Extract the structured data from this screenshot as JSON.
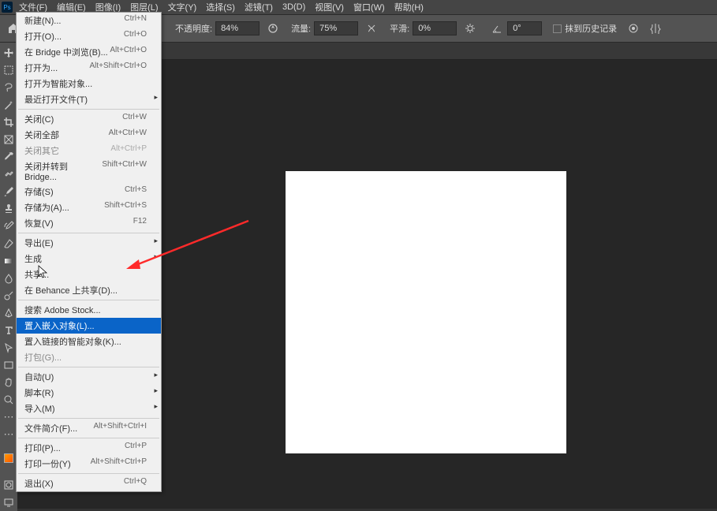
{
  "menubar": {
    "items": [
      "文件(F)",
      "编辑(E)",
      "图像(I)",
      "图层(L)",
      "文字(Y)",
      "选择(S)",
      "滤镜(T)",
      "3D(D)",
      "视图(V)",
      "窗口(W)",
      "帮助(H)"
    ]
  },
  "optionbar": {
    "opacity_label": "不透明度:",
    "opacity_value": "84%",
    "flow_label": "流量:",
    "flow_value": "75%",
    "smoothing_label": "平滑:",
    "smoothing_value": "0%",
    "angle_value": "0°",
    "history_label": "抹到历史记录"
  },
  "dropdown": {
    "items": [
      {
        "label": "新建(N)...",
        "shortcut": "Ctrl+N"
      },
      {
        "label": "打开(O)...",
        "shortcut": "Ctrl+O"
      },
      {
        "label": "在 Bridge 中浏览(B)...",
        "shortcut": "Alt+Ctrl+O"
      },
      {
        "label": "打开为...",
        "shortcut": "Alt+Shift+Ctrl+O"
      },
      {
        "label": "打开为智能对象..."
      },
      {
        "label": "最近打开文件(T)",
        "sub": true
      },
      {
        "sep": true
      },
      {
        "label": "关闭(C)",
        "shortcut": "Ctrl+W"
      },
      {
        "label": "关闭全部",
        "shortcut": "Alt+Ctrl+W"
      },
      {
        "label": "关闭其它",
        "shortcut": "Alt+Ctrl+P",
        "disabled": true
      },
      {
        "label": "关闭并转到 Bridge...",
        "shortcut": "Shift+Ctrl+W"
      },
      {
        "label": "存储(S)",
        "shortcut": "Ctrl+S"
      },
      {
        "label": "存储为(A)...",
        "shortcut": "Shift+Ctrl+S"
      },
      {
        "label": "恢复(V)",
        "shortcut": "F12"
      },
      {
        "sep": true
      },
      {
        "label": "导出(E)",
        "sub": true
      },
      {
        "label": "生成",
        "sub": true
      },
      {
        "label": "共享..."
      },
      {
        "label": "在 Behance 上共享(D)..."
      },
      {
        "sep": true
      },
      {
        "label": "搜索 Adobe Stock..."
      },
      {
        "label": "置入嵌入对象(L)...",
        "highlighted": true
      },
      {
        "label": "置入链接的智能对象(K)..."
      },
      {
        "label": "打包(G)...",
        "disabled": true
      },
      {
        "sep": true
      },
      {
        "label": "自动(U)",
        "sub": true
      },
      {
        "label": "脚本(R)",
        "sub": true
      },
      {
        "label": "导入(M)",
        "sub": true
      },
      {
        "sep": true
      },
      {
        "label": "文件简介(F)...",
        "shortcut": "Alt+Shift+Ctrl+I"
      },
      {
        "sep": true
      },
      {
        "label": "打印(P)...",
        "shortcut": "Ctrl+P"
      },
      {
        "label": "打印一份(Y)",
        "shortcut": "Alt+Shift+Ctrl+P"
      },
      {
        "sep": true
      },
      {
        "label": "退出(X)",
        "shortcut": "Ctrl+Q"
      }
    ]
  },
  "tools": [
    "move",
    "marquee",
    "lasso",
    "wand",
    "crop",
    "frame",
    "eyedropper",
    "healing",
    "brush",
    "stamp",
    "history",
    "eraser",
    "gradient",
    "blur",
    "dodge",
    "pen",
    "type",
    "path",
    "rect",
    "hand",
    "zoom",
    "ellipsis"
  ]
}
